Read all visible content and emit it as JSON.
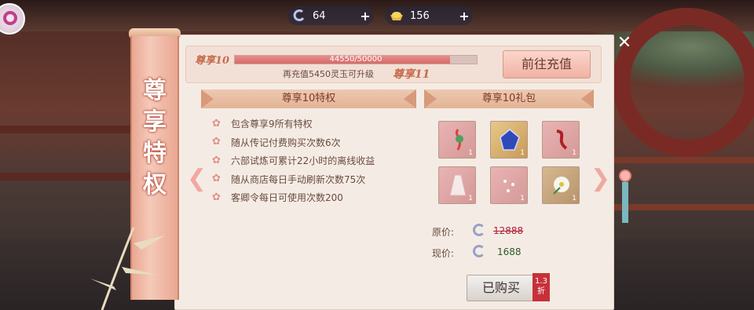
{
  "currency": {
    "jade": {
      "icon": "jade-currency-icon",
      "value": "64",
      "plus": "+"
    },
    "gold": {
      "icon": "gold-ingot-icon",
      "value": "156",
      "plus": "+"
    }
  },
  "banner": {
    "title_chars": [
      "尊",
      "享",
      "特",
      "权"
    ]
  },
  "vip": {
    "current_label": "尊享10",
    "next_label": "尊享11",
    "progress_text": "44550/50000",
    "progress_fraction": 0.891,
    "recharge_hint": "再充值5450灵玉可升级",
    "go_button": "前往充值"
  },
  "privileges": {
    "header": "尊享10特权",
    "items": [
      "包含尊享9所有特权",
      "随从传记付费购买次数6次",
      "六部试炼可累计22小时的离线收益",
      "随从商店每日手动刷新次数75次",
      "客卿令每日可使用次数200"
    ]
  },
  "gift": {
    "header": "尊享10礼包",
    "items": [
      {
        "name": "jade-ornament-icon",
        "qty": "1"
      },
      {
        "name": "blue-gem-icon",
        "qty": "1"
      },
      {
        "name": "red-hair-accessory-icon",
        "qty": "1"
      },
      {
        "name": "white-robe-icon",
        "qty": "1"
      },
      {
        "name": "pink-sparkle-item-icon",
        "qty": "1"
      },
      {
        "name": "white-flower-icon",
        "qty": "1"
      }
    ],
    "original_label": "原价:",
    "original_price": "12888",
    "current_label": "现价:",
    "current_price": "1688",
    "buy_button": "已购买",
    "discount": "1.3\n折"
  },
  "close": "✕",
  "colors": {
    "accent": "#e0908a",
    "price_strike": "#b0203a",
    "price_now": "#2d5a2a"
  }
}
